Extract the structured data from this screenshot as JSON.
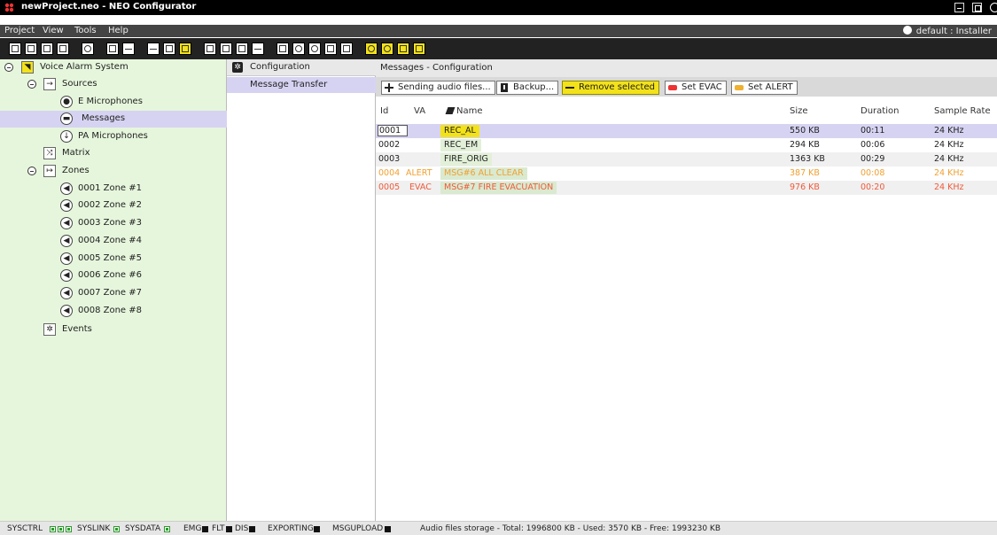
{
  "window": {
    "title": "newProject.neo - NEO Configurator"
  },
  "menu": {
    "items": [
      "Project",
      "View",
      "Tools",
      "Help"
    ],
    "user": "default : Installer"
  },
  "tree": {
    "root": "Voice Alarm System",
    "sources": "Sources",
    "e_microphones": "E Microphones",
    "messages": "Messages",
    "pa_microphones": "PA Microphones",
    "matrix": "Matrix",
    "zones": "Zones",
    "zone_items": [
      "0001 Zone #1",
      "0002 Zone #2",
      "0003 Zone #3",
      "0004 Zone #4",
      "0005 Zone #5",
      "0006 Zone #6",
      "0007 Zone #7",
      "0008 Zone #8"
    ],
    "events": "Events"
  },
  "middle": {
    "header": "Configuration",
    "item": "Message Transfer"
  },
  "right": {
    "header": "Messages - Configuration",
    "actions": {
      "sending": "Sending audio files...",
      "backup": "Backup...",
      "remove": "Remove selected",
      "set_evac": "Set EVAC",
      "set_alert": "Set ALERT"
    },
    "columns": {
      "id": "Id",
      "va": "VA",
      "name": "Name",
      "size": "Size",
      "duration": "Duration",
      "rate": "Sample Rate"
    },
    "rows": [
      {
        "id": "0001",
        "va": "",
        "name": "REC_AL",
        "size": "550 KB",
        "duration": "00:11",
        "rate": "24 KHz"
      },
      {
        "id": "0002",
        "va": "",
        "name": "REC_EM",
        "size": "294 KB",
        "duration": "00:06",
        "rate": "24 KHz"
      },
      {
        "id": "0003",
        "va": "",
        "name": "FIRE_ORIG",
        "size": "1363 KB",
        "duration": "00:29",
        "rate": "24 KHz"
      },
      {
        "id": "0004",
        "va": "ALERT",
        "name": "MSG#6 ALL CLEAR",
        "size": "387 KB",
        "duration": "00:08",
        "rate": "24 KHz"
      },
      {
        "id": "0005",
        "va": "EVAC",
        "name": "MSG#7 FIRE EVACUATION",
        "size": "976 KB",
        "duration": "00:20",
        "rate": "24 KHz"
      }
    ]
  },
  "status": {
    "sysctrl": "SYSCTRL",
    "syslink": "SYSLINK",
    "sysdata": "SYSDATA",
    "emg": "EMG",
    "flt": "FLT",
    "dis": "DIS",
    "exporting": "EXPORTING",
    "msgupload": "MSGUPLOAD",
    "storage": "Audio files storage - Total: 1996800 KB - Used: 3570 KB - Free: 1993230 KB"
  },
  "colors": {
    "accent_yellow": "#f3e21a",
    "selection": "#d6d3f2",
    "tree_bg": "#e6f6dc",
    "alert": "#f0a030",
    "evac": "#f05a3a"
  }
}
